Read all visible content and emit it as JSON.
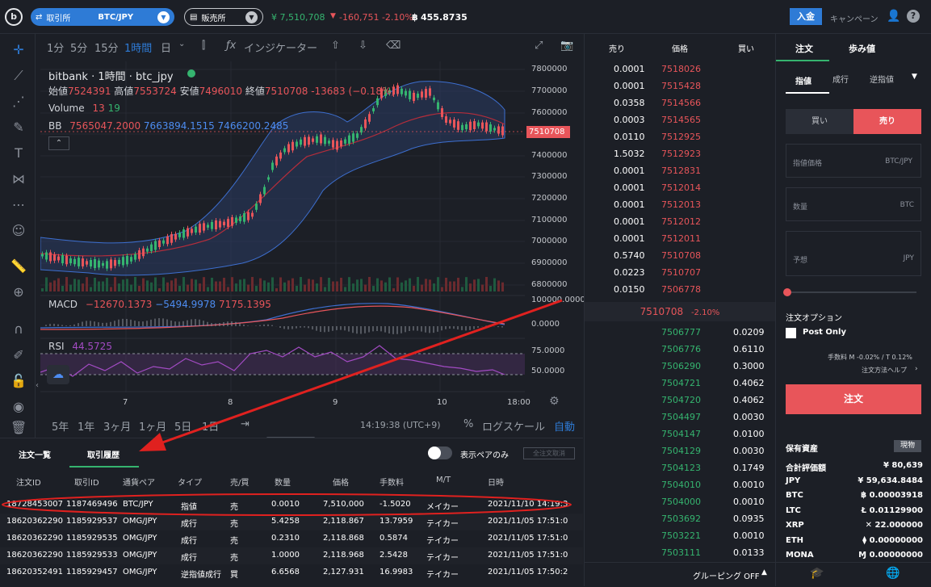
{
  "header": {
    "logo": "b",
    "market_label": "取引所",
    "market_pair": "BTC/JPY",
    "shop_label": "販売所",
    "last_price": "¥ 7,510,708",
    "change": "-160,751 -2.10%",
    "btc_balance": "455.8735",
    "deposit_label": "入金",
    "campaign_label": "キャンペーン",
    "help_icon": "?"
  },
  "chart_toolbar": {
    "intervals": [
      "1分",
      "5分",
      "15分",
      "1時間",
      "日"
    ],
    "active_interval": "1時間",
    "indicator_label": "インジケーター"
  },
  "chart_legend": {
    "title": "bitbank · 1時間 · btc_jpy",
    "ohlc_open_label": "始値",
    "ohlc_open": "7524391",
    "ohlc_high_label": "高値",
    "ohlc_high": "7553724",
    "ohlc_low_label": "安値",
    "ohlc_low": "7496010",
    "ohlc_close_label": "終値",
    "ohlc_close": "7510708",
    "ohlc_change": "-13683 (−0.18%)",
    "volume_label": "Volume",
    "volume_a": "13",
    "volume_b": "19",
    "bb_label": "BB",
    "bb_1": "7565047.2000",
    "bb_2": "7663894.1515",
    "bb_3": "7466200.2485",
    "current_price_tag": "7510708",
    "price_ticks": [
      "7800000",
      "7700000",
      "7600000",
      "7500000",
      "7400000",
      "7300000",
      "7200000",
      "7100000",
      "7000000",
      "6900000",
      "6800000"
    ],
    "macd_label": "MACD",
    "macd_1": "−12670.1373",
    "macd_2": "−5494.9978",
    "macd_3": "7175.1395",
    "macd_ticks": [
      "100000.0000",
      "0.0000"
    ],
    "rsi_label": "RSI",
    "rsi_value": "44.5725",
    "rsi_ticks": [
      "75.0000",
      "50.0000"
    ],
    "x_ticks": [
      "7",
      "8",
      "9",
      "10",
      "18:00"
    ]
  },
  "chart_bottom": {
    "ranges": [
      "5年",
      "1年",
      "3ヶ月",
      "1ヶ月",
      "5日",
      "1日"
    ],
    "time": "14:19:38 (UTC+9)",
    "percent": "%",
    "log": "ログスケール",
    "auto": "自動"
  },
  "order_book": {
    "headers": {
      "sell": "売り",
      "price": "価格",
      "buy": "買い"
    },
    "asks": [
      {
        "qty": "0.0001",
        "price": "7518026"
      },
      {
        "qty": "0.0001",
        "price": "7515428"
      },
      {
        "qty": "0.0358",
        "price": "7514566"
      },
      {
        "qty": "0.0003",
        "price": "7514565"
      },
      {
        "qty": "0.0110",
        "price": "7512925"
      },
      {
        "qty": "1.5032",
        "price": "7512923"
      },
      {
        "qty": "0.0001",
        "price": "7512831"
      },
      {
        "qty": "0.0001",
        "price": "7512014"
      },
      {
        "qty": "0.0001",
        "price": "7512013"
      },
      {
        "qty": "0.0001",
        "price": "7512012"
      },
      {
        "qty": "0.0001",
        "price": "7512011"
      },
      {
        "qty": "0.5740",
        "price": "7510708"
      },
      {
        "qty": "0.0223",
        "price": "7510707"
      },
      {
        "qty": "0.0150",
        "price": "7506778"
      }
    ],
    "mid_price": "7510708",
    "mid_change": "-2.10%",
    "bids": [
      {
        "price": "7506777",
        "qty": "0.0209"
      },
      {
        "price": "7506776",
        "qty": "0.6110"
      },
      {
        "price": "7506290",
        "qty": "0.3000"
      },
      {
        "price": "7504721",
        "qty": "0.4062"
      },
      {
        "price": "7504720",
        "qty": "0.4062"
      },
      {
        "price": "7504497",
        "qty": "0.0030"
      },
      {
        "price": "7504147",
        "qty": "0.0100"
      },
      {
        "price": "7504129",
        "qty": "0.0030"
      },
      {
        "price": "7504123",
        "qty": "0.1749"
      },
      {
        "price": "7504010",
        "qty": "0.0010"
      },
      {
        "price": "7504000",
        "qty": "0.0010"
      },
      {
        "price": "7503692",
        "qty": "0.0935"
      },
      {
        "price": "7503221",
        "qty": "0.0010"
      },
      {
        "price": "7503111",
        "qty": "0.0133"
      }
    ],
    "grouping_label": "グルーピング OFF"
  },
  "order_panel": {
    "tab_order": "注文",
    "tab_trades": "歩み値",
    "type_limit": "指値",
    "type_market": "成行",
    "type_stop": "逆指値",
    "buy_label": "買い",
    "sell_label": "売り",
    "limit_price_label": "指値価格",
    "limit_price_unit": "BTC/JPY",
    "qty_label": "数量",
    "qty_unit": "BTC",
    "estimate_label": "予想",
    "estimate_unit": "JPY",
    "options_label": "注文オプション",
    "post_only_label": "Post Only",
    "fee_text": "手数料 M -0.02% / T 0.12%",
    "help_text": "注文方法ヘルプ",
    "submit_label": "注文",
    "holdings_title": "保有資産",
    "holdings_button": "現物",
    "holdings": [
      {
        "name": "合計評価額",
        "value": "¥ 80,639"
      },
      {
        "name": "JPY",
        "value": "¥ 59,634.8484"
      },
      {
        "name": "BTC",
        "value": "฿ 0.00003918"
      },
      {
        "name": "LTC",
        "value": "Ł 0.01129900"
      },
      {
        "name": "XRP",
        "value": "✕ 22.000000"
      },
      {
        "name": "ETH",
        "value": "⧫ 0.00000000"
      },
      {
        "name": "MONA",
        "value": "Ɱ 0.00000000"
      }
    ]
  },
  "history": {
    "tab_orders": "注文一覧",
    "tab_history": "取引履歴",
    "toggle_label": "表示ペアのみ",
    "cancel_all": "全注文取消",
    "columns": [
      "注文ID",
      "取引ID",
      "通貨ペア",
      "タイプ",
      "売/買",
      "数量",
      "価格",
      "手数料",
      "M/T",
      "日時"
    ],
    "rows": [
      [
        "18728453007",
        "1187469496",
        "BTC/JPY",
        "指値",
        "売",
        "0.0010",
        "7,510,000",
        "-1.5020",
        "メイカー",
        "2021/11/10 14:19:31"
      ],
      [
        "18620362290",
        "1185929537",
        "OMG/JPY",
        "成行",
        "売",
        "5.4258",
        "2,118.867",
        "13.7959",
        "テイカー",
        "2021/11/05 17:51:01"
      ],
      [
        "18620362290",
        "1185929535",
        "OMG/JPY",
        "成行",
        "売",
        "0.2310",
        "2,118.868",
        "0.5874",
        "テイカー",
        "2021/11/05 17:51:01"
      ],
      [
        "18620362290",
        "1185929533",
        "OMG/JPY",
        "成行",
        "売",
        "1.0000",
        "2,118.968",
        "2.5428",
        "テイカー",
        "2021/11/05 17:51:01"
      ],
      [
        "18620352491",
        "1185929457",
        "OMG/JPY",
        "逆指値成行",
        "買",
        "6.6568",
        "2,127.931",
        "16.9983",
        "テイカー",
        "2021/11/05 17:50:27"
      ]
    ]
  },
  "colors": {
    "accent": "#2e7bd6",
    "up": "#35b46f",
    "down": "#e8555a",
    "annotation": "#e0211f"
  }
}
